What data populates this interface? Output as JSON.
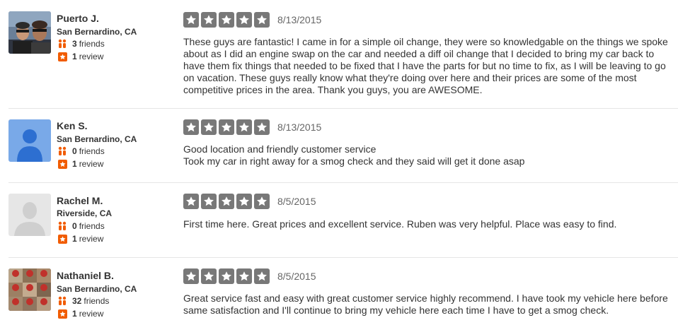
{
  "colors": {
    "star_bg": "#787878",
    "review_icon": "#f15c00",
    "friends_icon": "#f15c00",
    "divider": "#e6e6e6"
  },
  "reviews": [
    {
      "user": {
        "name": "Puerto J.",
        "location": "San Bernardino, CA",
        "friends_count": "3",
        "friends_label": "friends",
        "review_count": "1",
        "review_label": "review"
      },
      "rating": 5,
      "date": "8/13/2015",
      "text": "These guys are fantastic! I came in for a simple oil change, they were so knowledgable on the things we spoke about as I did an engine swap on the car and needed a diff oil change that I decided to bring my car back to have them fix things that needed to be fixed that I have the parts for but no time to fix, as I will be leaving to go on vacation. These guys really know what they're doing over here and their prices are some of the most competitive prices in the area. Thank you guys, you are AWESOME."
    },
    {
      "user": {
        "name": "Ken S.",
        "location": "San Bernardino, CA",
        "friends_count": "0",
        "friends_label": "friends",
        "review_count": "1",
        "review_label": "review"
      },
      "rating": 5,
      "date": "8/13/2015",
      "text_lines": [
        "Good location and friendly customer service",
        "Took my car in right away for a smog check and they said will get it done asap"
      ]
    },
    {
      "user": {
        "name": "Rachel M.",
        "location": "Riverside, CA",
        "friends_count": "0",
        "friends_label": "friends",
        "review_count": "1",
        "review_label": "review"
      },
      "rating": 5,
      "date": "8/5/2015",
      "text": "First time here. Great prices and excellent service. Ruben was very helpful. Place was easy to find."
    },
    {
      "user": {
        "name": "Nathaniel B.",
        "location": "San Bernardino, CA",
        "friends_count": "32",
        "friends_label": "friends",
        "review_count": "1",
        "review_label": "review"
      },
      "rating": 5,
      "date": "8/5/2015",
      "text": "Great service fast and easy with great customer service highly recommend. I have took my vehicle here before same satisfaction and I'll continue to bring my vehicle here each time I have to get a smog check."
    }
  ]
}
